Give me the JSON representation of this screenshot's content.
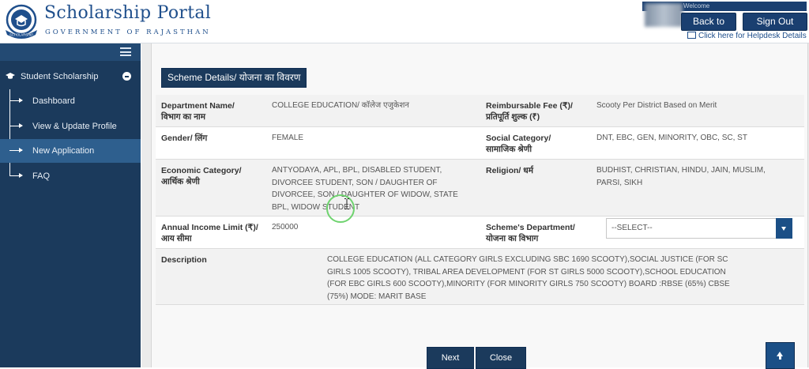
{
  "header": {
    "title": "Scholarship Portal",
    "subtitle": "GOVERNMENT OF RAJASTHAN",
    "welcome": "Welcome",
    "back_to_sso": "Back to SSO",
    "sign_out": "Sign Out",
    "helpdesk": "Click here for Helpdesk Details",
    "logo_text": "SCHOLARSHIP"
  },
  "sidebar": {
    "section": "Student Scholarship",
    "items": [
      {
        "label": "Dashboard",
        "active": false
      },
      {
        "label": "View & Update Profile",
        "active": false
      },
      {
        "label": "New Application",
        "active": true
      },
      {
        "label": "FAQ",
        "active": false
      }
    ]
  },
  "main": {
    "panel_title": "Scheme Details/ योजना का विवरण",
    "rows": [
      {
        "left_label": [
          "Department Name/",
          "विभाग का नाम"
        ],
        "left_value": [
          "COLLEGE EDUCATION/ कॉलेज एजुकेशन"
        ],
        "right_label": [
          "Reimbursable Fee (₹)/",
          "प्रतिपूर्ति शुल्क (₹)"
        ],
        "right_value": [
          "Scooty Per District Based on Merit"
        ]
      },
      {
        "left_label": [
          "Gender/ लिंग"
        ],
        "left_value": [
          "FEMALE"
        ],
        "right_label": [
          "Social Category/",
          "सामाजिक श्रेणी"
        ],
        "right_value": [
          "DNT, EBC, GEN, MINORITY, OBC, SC, ST"
        ]
      },
      {
        "left_label": [
          "Economic Category/",
          "आर्थिक श्रेणी"
        ],
        "left_value": [
          "ANTYODAYA, APL, BPL, DISABLED STUDENT,",
          "DIVORCEE STUDENT, SON / DAUGHTER OF",
          "DIVORCEE, SON / DAUGHTER OF WIDOW, STATE",
          "BPL, WIDOW STUDENT"
        ],
        "right_label": [
          "Religion/ धर्म"
        ],
        "right_value": [
          "BUDHIST, CHRISTIAN, HINDU, JAIN, MUSLIM,",
          "PARSI, SIKH"
        ]
      },
      {
        "left_label": [
          "Annual Income Limit (₹)/",
          "आय सीमा"
        ],
        "left_value": [
          "250000"
        ],
        "right_label": [
          "Scheme's Department/",
          "योजना का विभाग"
        ],
        "select_value": "--SELECT--"
      }
    ],
    "description_label": "Description",
    "description_lines": [
      "COLLEGE EDUCATION (ALL CATEGORY GIRLS EXCLUDING SBC 1690 SCOOTY),SOCIAL JUSTICE (FOR SC",
      "GIRLS 1005 SCOOTY), TRIBAL AREA DEVELOPMENT (FOR ST GIRLS 5000 SCOOTY),SCHOOL EDUCATION",
      "(FOR EBC GIRLS 600 SCOOTY),MINORITY (FOR MINORITY GIRLS 750 SCOOTY) BOARD :RBSE (65%) CBSE",
      "(75%) MODE: MARIT BASE"
    ]
  },
  "footer": {
    "next": "Next",
    "close": "Close"
  },
  "colors": {
    "navy": "#1b3a5c",
    "accent_blue": "#1b4f86",
    "active_item": "#2e5f8e",
    "cursor_ring": "#6fd36f"
  },
  "icons": [
    "logo-emblem",
    "mail-icon",
    "hamburger-icon",
    "graduation-cap-icon",
    "collapse-minus-icon",
    "arrow-right-icon",
    "dropdown-caret-icon",
    "scroll-top-arrow-icon",
    "text-cursor-icon"
  ]
}
